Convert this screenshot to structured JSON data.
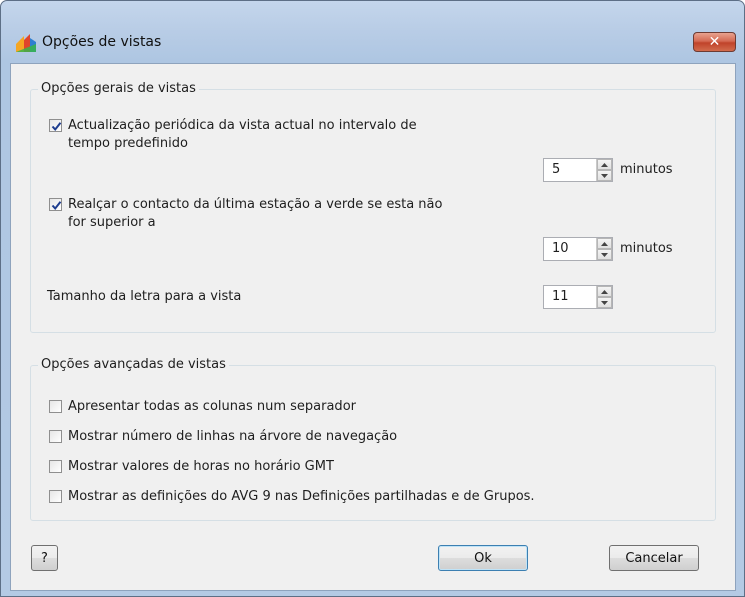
{
  "window": {
    "title": "Opções de vistas",
    "close_icon": "close-icon"
  },
  "colors": {
    "title_bg": "#b9cde6",
    "close_red": "#c94b31",
    "client_bg": "#f0f0f0",
    "check_blue": "#1e3d8f"
  },
  "general_group": {
    "title": "Opções gerais de vistas",
    "periodic_update": {
      "checked": true,
      "label_line1": "Actualização periódica da vista actual no intervalo de",
      "label_line2": "tempo predefinido",
      "interval_value": "5",
      "unit": "minutos"
    },
    "highlight_contact": {
      "checked": true,
      "label_line1": "Realçar o contacto da última estação a verde se esta não",
      "label_line2": "for superior a",
      "interval_value": "10",
      "unit": "minutos"
    },
    "font_size": {
      "label": "Tamanho da letra para a vista",
      "value": "11"
    }
  },
  "advanced_group": {
    "title": "Opções avançadas de vistas",
    "options": [
      {
        "label": "Apresentar todas as colunas num separador",
        "checked": false
      },
      {
        "label": "Mostrar número de linhas na árvore de navegação",
        "checked": false
      },
      {
        "label": "Mostrar valores de horas no horário GMT",
        "checked": false
      },
      {
        "label": "Mostrar as definições do AVG 9 nas Definições partilhadas e de Grupos.",
        "checked": false
      }
    ]
  },
  "buttons": {
    "help": "?",
    "ok": "Ok",
    "cancel": "Cancelar"
  }
}
